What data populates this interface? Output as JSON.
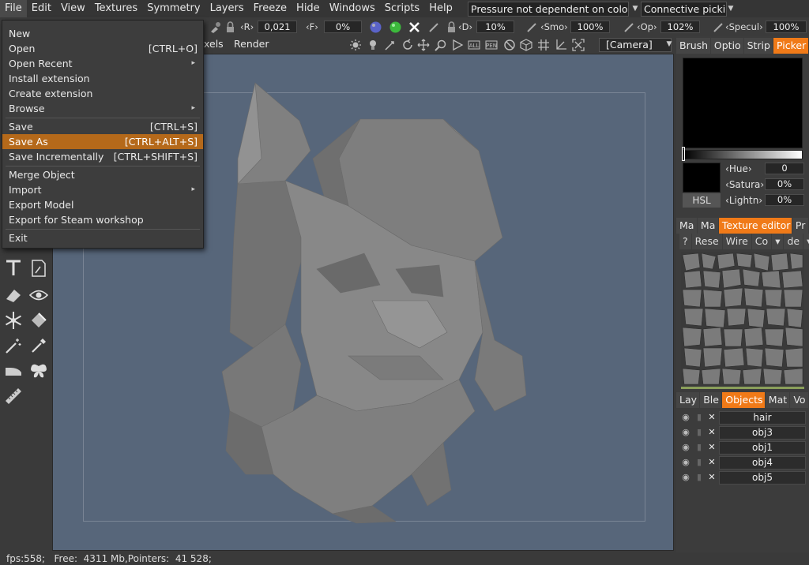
{
  "menubar": {
    "items": [
      "File",
      "Edit",
      "View",
      "Textures",
      "Symmetry",
      "Layers",
      "Freeze",
      "Hide",
      "Windows",
      "Scripts",
      "Help"
    ],
    "pressure_dropdown": "Pressure not dependent on colo",
    "picking_dropdown": "Connective picki"
  },
  "toolbar": {
    "radius_label": "R",
    "radius_value": "0,021",
    "falloff_label": "F",
    "falloff_value": "0%",
    "depth_label": "D",
    "depth_value": "10%",
    "smooth_label": "Smo",
    "smooth_value": "100%",
    "opacity_label": "Op",
    "opacity_value": "102%",
    "specular_label": "Specul",
    "specular_value": "100%",
    "pixels_label": "xels",
    "render_label": "Render",
    "camera_label": "[Camera]"
  },
  "file_menu": {
    "items": [
      {
        "label": "New",
        "shortcut": ""
      },
      {
        "label": "Open",
        "shortcut": "[CTRL+O]"
      },
      {
        "label": "Open Recent",
        "shortcut": ""
      },
      {
        "label": "Install extension",
        "shortcut": ""
      },
      {
        "label": "Create extension",
        "shortcut": ""
      },
      {
        "label": "Browse",
        "shortcut": ""
      },
      {
        "label": "Save",
        "shortcut": "[CTRL+S]"
      },
      {
        "label": "Save As",
        "shortcut": "[CTRL+ALT+S]"
      },
      {
        "label": "Save Incrementally",
        "shortcut": "[CTRL+SHIFT+S]"
      },
      {
        "label": "Merge Object",
        "shortcut": ""
      },
      {
        "label": "Import",
        "shortcut": ""
      },
      {
        "label": "Export Model",
        "shortcut": ""
      },
      {
        "label": "Export for Steam workshop",
        "shortcut": ""
      },
      {
        "label": "Exit",
        "shortcut": ""
      }
    ]
  },
  "right_panel": {
    "top_tabs": [
      "Brush",
      "Optio",
      "Strip",
      "Picker"
    ],
    "hsl_button": "HSL",
    "hue_label": "Hue",
    "hue_value": "0",
    "saturation_label": "Satura",
    "saturation_value": "0%",
    "lightness_label": "Lightn",
    "lightness_value": "0%",
    "mid_tabs": [
      "Ma",
      "Ma",
      "Texture editor",
      "Pr"
    ],
    "tex_buttons": [
      "?",
      "Rese",
      "Wire",
      "Co",
      "de"
    ],
    "bottom_tabs": [
      "Lay",
      "Ble",
      "Objects",
      "Mat",
      "Vo"
    ],
    "objects": [
      "hair",
      "obj3",
      "obj1",
      "obj4",
      "obj5"
    ]
  },
  "status": {
    "text": "fps:558;   Free:  4311 Mb,Pointers:  41 528;"
  },
  "colors": {
    "accent": "#f07a18",
    "menu_highlight": "#b5691a",
    "viewport_bg": "#57667a"
  }
}
